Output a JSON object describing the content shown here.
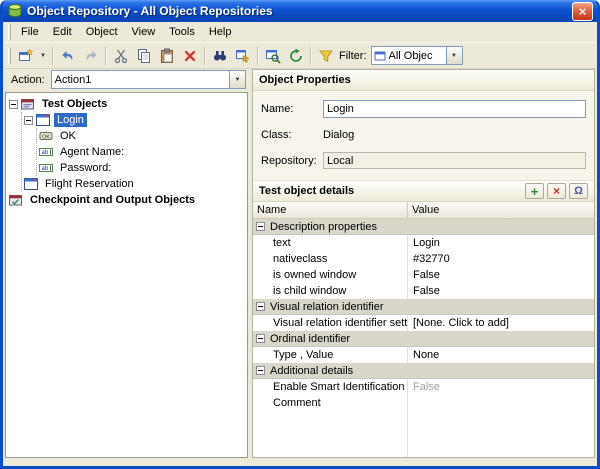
{
  "window": {
    "title": "Object Repository - All Object Repositories"
  },
  "glyphs": {
    "close": "×",
    "dropdown": "▼",
    "plus": "+",
    "remove": "×",
    "restore": "Ω"
  },
  "menu": {
    "items": [
      "File",
      "Edit",
      "Object",
      "View",
      "Tools",
      "Help"
    ]
  },
  "toolbar": {
    "icons": [
      "new-object",
      "undo",
      "redo",
      "cut",
      "copy",
      "paste",
      "delete",
      "find",
      "highlight",
      "locate",
      "update",
      "filter"
    ],
    "filter_label": "Filter:",
    "filter_value": "All Objec"
  },
  "action_bar": {
    "label": "Action:",
    "value": "Action1"
  },
  "tree": {
    "items": [
      {
        "label": "Test Objects"
      },
      {
        "label": "Login"
      },
      {
        "label": "OK"
      },
      {
        "label": "Agent Name:"
      },
      {
        "label": "Password:"
      },
      {
        "label": "Flight Reservation"
      },
      {
        "label": "Checkpoint and Output Objects"
      }
    ]
  },
  "properties": {
    "header": "Object Properties",
    "name_label": "Name:",
    "name_value": "Login",
    "class_label": "Class:",
    "class_value": "Dialog",
    "repository_label": "Repository:",
    "repository_value": "Local"
  },
  "details": {
    "header": "Test object details",
    "columns": [
      "Name",
      "Value"
    ],
    "groups": [
      {
        "label": "Description properties",
        "rows": [
          {
            "name": "text",
            "value": "Login"
          },
          {
            "name": "nativeclass",
            "value": "#32770"
          },
          {
            "name": "is owned window",
            "value": "False"
          },
          {
            "name": "is child window",
            "value": "False"
          }
        ]
      },
      {
        "label": "Visual relation identifier",
        "rows": [
          {
            "name": "Visual relation identifier settings",
            "value": "[None. Click to add]"
          }
        ]
      },
      {
        "label": "Ordinal identifier",
        "rows": [
          {
            "name": "Type , Value",
            "value": "None"
          }
        ]
      },
      {
        "label": "Additional details",
        "rows": [
          {
            "name": "Enable Smart Identification",
            "value": "False"
          },
          {
            "name": "Comment",
            "value": ""
          }
        ]
      }
    ]
  },
  "colors": {
    "selection": "#316AC5",
    "titlebar": "#0D51CE",
    "window_border": "#0B4DC8"
  }
}
